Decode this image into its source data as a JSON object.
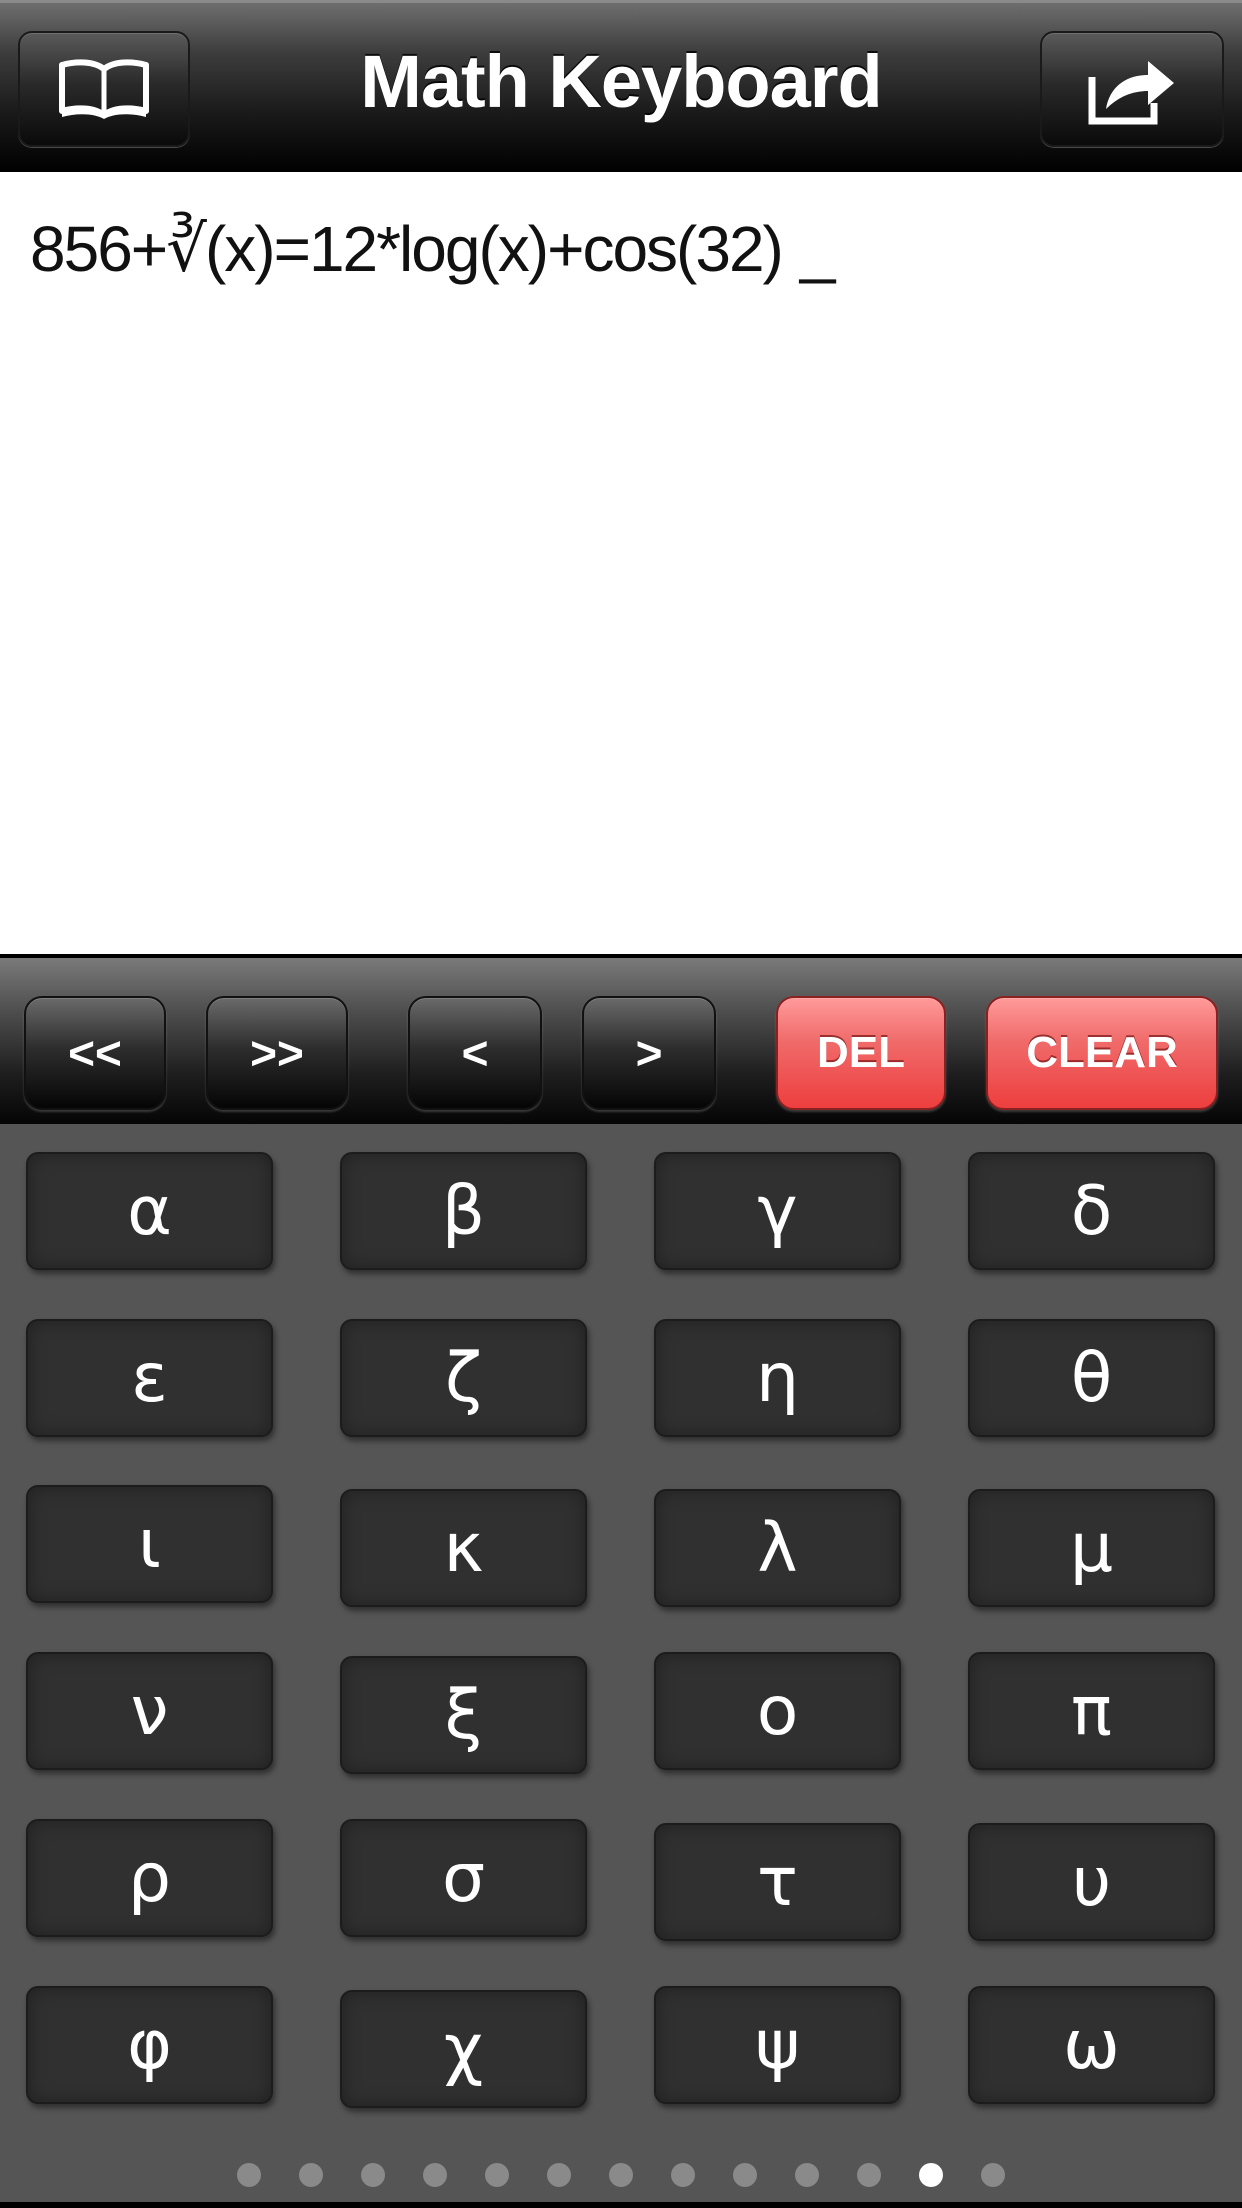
{
  "header": {
    "title": "Math Keyboard",
    "left_button_icon": "book-icon",
    "right_button_icon": "share-icon"
  },
  "display": {
    "expression": "856+∛(x)=12*log(x)+cos(32)",
    "cursor": "_"
  },
  "toolbar": {
    "buttons": [
      {
        "id": "jump-left",
        "label": "<<"
      },
      {
        "id": "jump-right",
        "label": ">>"
      },
      {
        "id": "move-left",
        "label": "<"
      },
      {
        "id": "move-right",
        "label": ">"
      },
      {
        "id": "delete",
        "label": "DEL"
      },
      {
        "id": "clear",
        "label": "CLEAR"
      }
    ],
    "accent_color": "#f04848"
  },
  "keyboard": {
    "keys": [
      "α",
      "β",
      "γ",
      "δ",
      "ε",
      "ζ",
      "η",
      "θ",
      "ι",
      "κ",
      "λ",
      "μ",
      "ν",
      "ξ",
      "ο",
      "π",
      "ρ",
      "σ",
      "τ",
      "υ",
      "φ",
      "χ",
      "ψ",
      "ω"
    ]
  },
  "pagination": {
    "total_pages": 13,
    "current_page": 12
  }
}
